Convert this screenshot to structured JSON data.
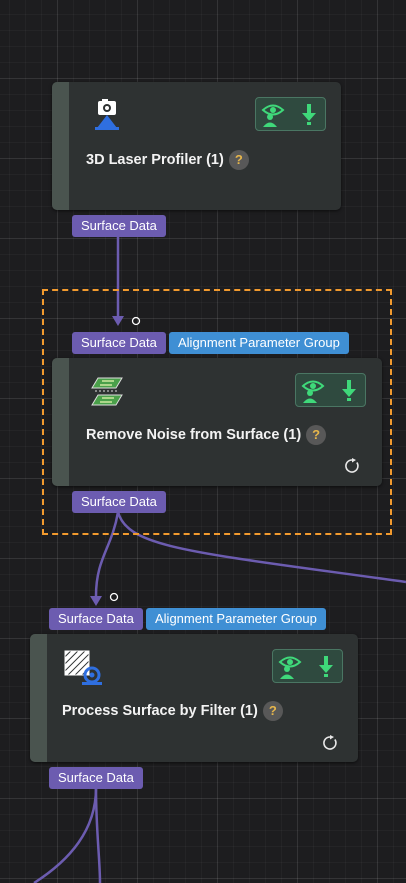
{
  "nodes": [
    {
      "title": "3D Laser Profiler (1)",
      "icon": "camera-icon",
      "help": "?",
      "output_port": "Surface Data"
    },
    {
      "title": "Remove Noise from Surface (1)",
      "icon": "layered-surface-icon",
      "help": "?",
      "input_ports": [
        "Surface Data",
        "Alignment Parameter Group"
      ],
      "output_port": "Surface Data",
      "selected": true
    },
    {
      "title": "Process Surface by Filter (1)",
      "icon": "filter-surface-icon",
      "help": "?",
      "input_ports": [
        "Surface Data",
        "Alignment Parameter Group"
      ],
      "output_port": "Surface Data"
    }
  ],
  "colors": {
    "canvas": "#1d1d1f",
    "node": "#2e3232",
    "data_port": "#6c5cb0",
    "alignment_port": "#3f8fd4",
    "connection": "#6c5cb0",
    "selection": "#f29a2e",
    "action_green": "#3fd97a"
  }
}
